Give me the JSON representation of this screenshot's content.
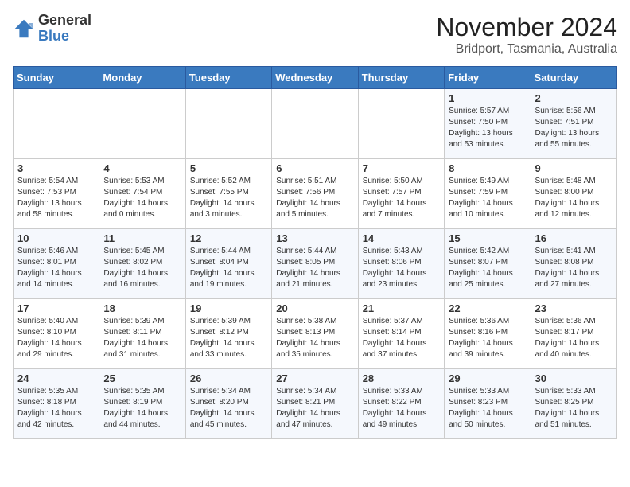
{
  "logo": {
    "general": "General",
    "blue": "Blue"
  },
  "title": "November 2024",
  "location": "Bridport, Tasmania, Australia",
  "days_of_week": [
    "Sunday",
    "Monday",
    "Tuesday",
    "Wednesday",
    "Thursday",
    "Friday",
    "Saturday"
  ],
  "weeks": [
    [
      {
        "day": "",
        "info": ""
      },
      {
        "day": "",
        "info": ""
      },
      {
        "day": "",
        "info": ""
      },
      {
        "day": "",
        "info": ""
      },
      {
        "day": "",
        "info": ""
      },
      {
        "day": "1",
        "info": "Sunrise: 5:57 AM\nSunset: 7:50 PM\nDaylight: 13 hours and 53 minutes."
      },
      {
        "day": "2",
        "info": "Sunrise: 5:56 AM\nSunset: 7:51 PM\nDaylight: 13 hours and 55 minutes."
      }
    ],
    [
      {
        "day": "3",
        "info": "Sunrise: 5:54 AM\nSunset: 7:53 PM\nDaylight: 13 hours and 58 minutes."
      },
      {
        "day": "4",
        "info": "Sunrise: 5:53 AM\nSunset: 7:54 PM\nDaylight: 14 hours and 0 minutes."
      },
      {
        "day": "5",
        "info": "Sunrise: 5:52 AM\nSunset: 7:55 PM\nDaylight: 14 hours and 3 minutes."
      },
      {
        "day": "6",
        "info": "Sunrise: 5:51 AM\nSunset: 7:56 PM\nDaylight: 14 hours and 5 minutes."
      },
      {
        "day": "7",
        "info": "Sunrise: 5:50 AM\nSunset: 7:57 PM\nDaylight: 14 hours and 7 minutes."
      },
      {
        "day": "8",
        "info": "Sunrise: 5:49 AM\nSunset: 7:59 PM\nDaylight: 14 hours and 10 minutes."
      },
      {
        "day": "9",
        "info": "Sunrise: 5:48 AM\nSunset: 8:00 PM\nDaylight: 14 hours and 12 minutes."
      }
    ],
    [
      {
        "day": "10",
        "info": "Sunrise: 5:46 AM\nSunset: 8:01 PM\nDaylight: 14 hours and 14 minutes."
      },
      {
        "day": "11",
        "info": "Sunrise: 5:45 AM\nSunset: 8:02 PM\nDaylight: 14 hours and 16 minutes."
      },
      {
        "day": "12",
        "info": "Sunrise: 5:44 AM\nSunset: 8:04 PM\nDaylight: 14 hours and 19 minutes."
      },
      {
        "day": "13",
        "info": "Sunrise: 5:44 AM\nSunset: 8:05 PM\nDaylight: 14 hours and 21 minutes."
      },
      {
        "day": "14",
        "info": "Sunrise: 5:43 AM\nSunset: 8:06 PM\nDaylight: 14 hours and 23 minutes."
      },
      {
        "day": "15",
        "info": "Sunrise: 5:42 AM\nSunset: 8:07 PM\nDaylight: 14 hours and 25 minutes."
      },
      {
        "day": "16",
        "info": "Sunrise: 5:41 AM\nSunset: 8:08 PM\nDaylight: 14 hours and 27 minutes."
      }
    ],
    [
      {
        "day": "17",
        "info": "Sunrise: 5:40 AM\nSunset: 8:10 PM\nDaylight: 14 hours and 29 minutes."
      },
      {
        "day": "18",
        "info": "Sunrise: 5:39 AM\nSunset: 8:11 PM\nDaylight: 14 hours and 31 minutes."
      },
      {
        "day": "19",
        "info": "Sunrise: 5:39 AM\nSunset: 8:12 PM\nDaylight: 14 hours and 33 minutes."
      },
      {
        "day": "20",
        "info": "Sunrise: 5:38 AM\nSunset: 8:13 PM\nDaylight: 14 hours and 35 minutes."
      },
      {
        "day": "21",
        "info": "Sunrise: 5:37 AM\nSunset: 8:14 PM\nDaylight: 14 hours and 37 minutes."
      },
      {
        "day": "22",
        "info": "Sunrise: 5:36 AM\nSunset: 8:16 PM\nDaylight: 14 hours and 39 minutes."
      },
      {
        "day": "23",
        "info": "Sunrise: 5:36 AM\nSunset: 8:17 PM\nDaylight: 14 hours and 40 minutes."
      }
    ],
    [
      {
        "day": "24",
        "info": "Sunrise: 5:35 AM\nSunset: 8:18 PM\nDaylight: 14 hours and 42 minutes."
      },
      {
        "day": "25",
        "info": "Sunrise: 5:35 AM\nSunset: 8:19 PM\nDaylight: 14 hours and 44 minutes."
      },
      {
        "day": "26",
        "info": "Sunrise: 5:34 AM\nSunset: 8:20 PM\nDaylight: 14 hours and 45 minutes."
      },
      {
        "day": "27",
        "info": "Sunrise: 5:34 AM\nSunset: 8:21 PM\nDaylight: 14 hours and 47 minutes."
      },
      {
        "day": "28",
        "info": "Sunrise: 5:33 AM\nSunset: 8:22 PM\nDaylight: 14 hours and 49 minutes."
      },
      {
        "day": "29",
        "info": "Sunrise: 5:33 AM\nSunset: 8:23 PM\nDaylight: 14 hours and 50 minutes."
      },
      {
        "day": "30",
        "info": "Sunrise: 5:33 AM\nSunset: 8:25 PM\nDaylight: 14 hours and 51 minutes."
      }
    ]
  ]
}
